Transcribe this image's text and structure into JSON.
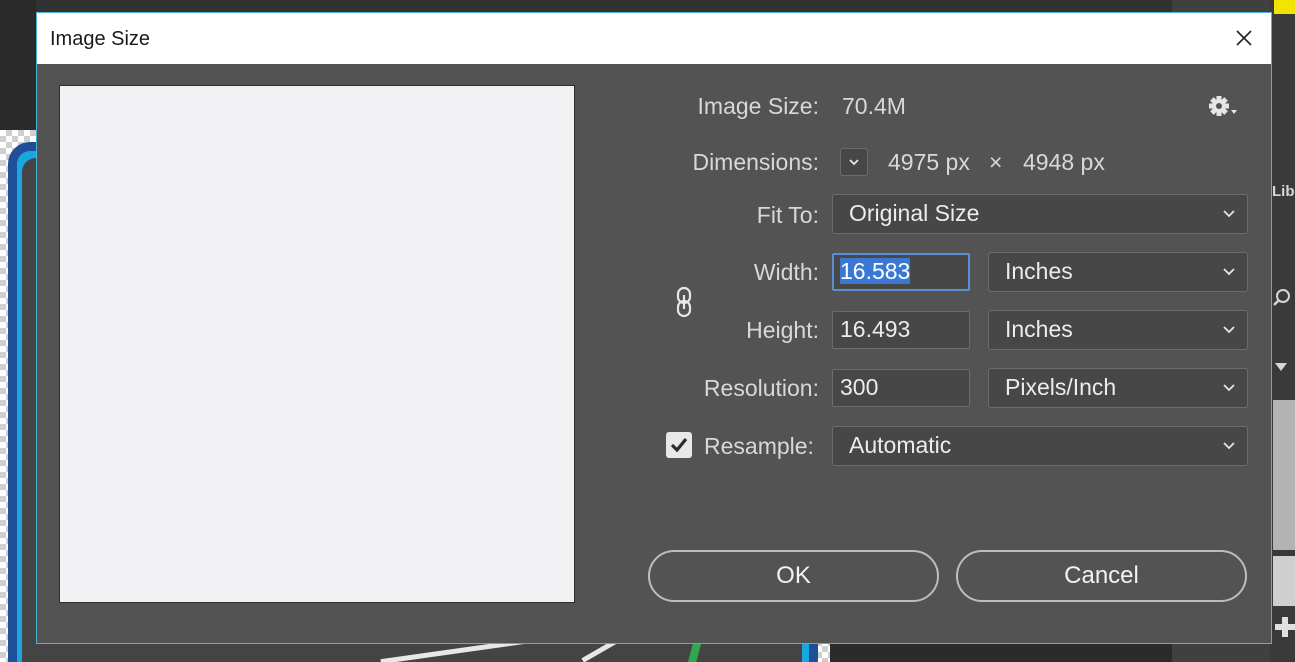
{
  "dialog": {
    "title": "Image Size",
    "image_size_label": "Image Size:",
    "image_size_value": "70.4M",
    "dimensions_label": "Dimensions:",
    "dim_width": "4975 px",
    "dim_times": "×",
    "dim_height": "4948 px",
    "fit_to_label": "Fit To:",
    "fit_to_value": "Original Size",
    "width_label": "Width:",
    "width_value": "16.583",
    "width_unit": "Inches",
    "height_label": "Height:",
    "height_value": "16.493",
    "height_unit": "Inches",
    "resolution_label": "Resolution:",
    "resolution_value": "300",
    "resolution_unit": "Pixels/Inch",
    "resample_label": "Resample:",
    "resample_checked": true,
    "resample_value": "Automatic",
    "ok_label": "OK",
    "cancel_label": "Cancel"
  },
  "background": {
    "panel_label": "Lib"
  },
  "icons": [
    "close-icon",
    "gear-icon",
    "chevron-down-icon",
    "chain-link-icon",
    "checkmark-icon",
    "search-icon",
    "plus-icon"
  ],
  "colors": {
    "dialog_bg": "#535353",
    "titlebar_bg": "#ffffff",
    "accent_selection": "#3a78d4",
    "focus_border": "#5a8fd6",
    "dialog_border": "#4fb3d9"
  }
}
